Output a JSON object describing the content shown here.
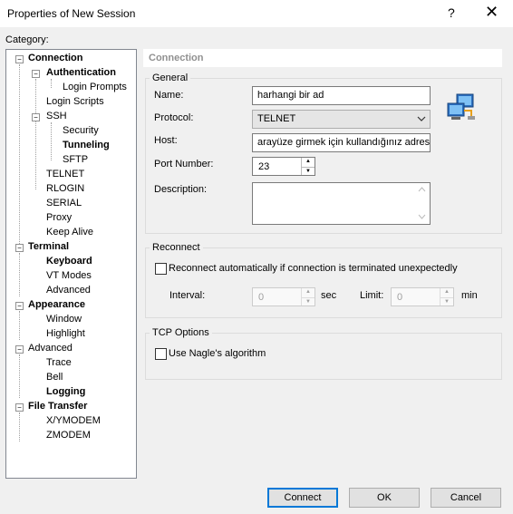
{
  "window": {
    "title": "Properties of New Session",
    "help_glyph": "?",
    "close_glyph": "✕"
  },
  "category_label": "Category:",
  "tree": [
    {
      "label": "Connection",
      "bold": true
    },
    {
      "label": "Authentication",
      "bold": true
    },
    {
      "label": "Login Prompts",
      "bold": false
    },
    {
      "label": "Login Scripts",
      "bold": false
    },
    {
      "label": "SSH",
      "bold": false
    },
    {
      "label": "Security",
      "bold": false
    },
    {
      "label": "Tunneling",
      "bold": true
    },
    {
      "label": "SFTP",
      "bold": false
    },
    {
      "label": "TELNET",
      "bold": false
    },
    {
      "label": "RLOGIN",
      "bold": false
    },
    {
      "label": "SERIAL",
      "bold": false
    },
    {
      "label": "Proxy",
      "bold": false
    },
    {
      "label": "Keep Alive",
      "bold": false
    },
    {
      "label": "Terminal",
      "bold": true
    },
    {
      "label": "Keyboard",
      "bold": true
    },
    {
      "label": "VT Modes",
      "bold": false
    },
    {
      "label": "Advanced",
      "bold": false
    },
    {
      "label": "Appearance",
      "bold": true
    },
    {
      "label": "Window",
      "bold": false
    },
    {
      "label": "Highlight",
      "bold": false
    },
    {
      "label": "Advanced",
      "bold": false
    },
    {
      "label": "Trace",
      "bold": false
    },
    {
      "label": "Bell",
      "bold": false
    },
    {
      "label": "Logging",
      "bold": true
    },
    {
      "label": "File Transfer",
      "bold": true
    },
    {
      "label": "X/YMODEM",
      "bold": false
    },
    {
      "label": "ZMODEM",
      "bold": false
    }
  ],
  "panel_title": "Connection",
  "general": {
    "title": "General",
    "name_label": "Name:",
    "name_value": "harhangi bir ad",
    "protocol_label": "Protocol:",
    "protocol_value": "TELNET",
    "host_label": "Host:",
    "host_value": "arayüze girmek için kullandığınız adres",
    "port_label": "Port Number:",
    "port_value": "23",
    "description_label": "Description:",
    "description_value": ""
  },
  "reconnect": {
    "title": "Reconnect",
    "checkbox_label": "Reconnect automatically if connection is terminated unexpectedly",
    "checked": false,
    "interval_label": "Interval:",
    "interval_value": "0",
    "interval_unit": "sec",
    "limit_label": "Limit:",
    "limit_value": "0",
    "limit_unit": "min"
  },
  "tcp": {
    "title": "TCP Options",
    "nagle_label": "Use Nagle's algorithm",
    "checked": false
  },
  "buttons": {
    "connect": "Connect",
    "ok": "OK",
    "cancel": "Cancel"
  },
  "colors": {
    "accent": "#0078d7"
  }
}
